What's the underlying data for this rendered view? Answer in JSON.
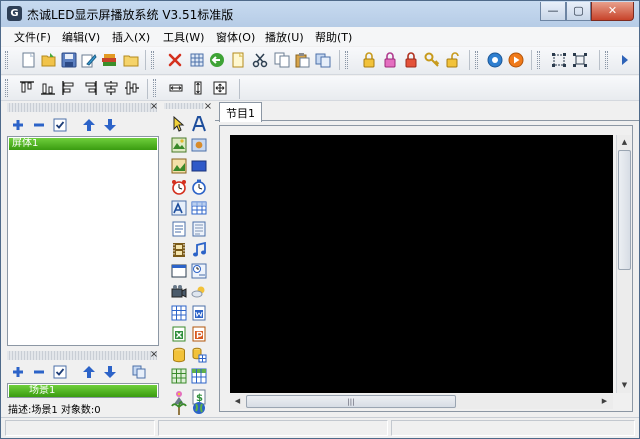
{
  "window": {
    "title": "杰诚LED显示屏播放系统 V3.51标准版",
    "logo_glyph": "G",
    "controls": {
      "minimize": "—",
      "maximize": "▢",
      "close": "✕"
    }
  },
  "menu": [
    {
      "label": "文件(F)"
    },
    {
      "label": "编辑(V)"
    },
    {
      "label": "插入(X)"
    },
    {
      "label": "工具(W)"
    },
    {
      "label": "窗体(O)"
    },
    {
      "label": "播放(U)"
    },
    {
      "label": "帮助(T)"
    }
  ],
  "toolbar_main": [
    {
      "icon": "new-file-icon"
    },
    {
      "icon": "open-folder-icon"
    },
    {
      "icon": "save-icon"
    },
    {
      "icon": "edit-icon"
    },
    {
      "icon": "books-icon"
    },
    {
      "icon": "folder-icon"
    },
    {
      "icon": "delete-icon"
    },
    {
      "icon": "grid-icon"
    },
    {
      "icon": "go-back-icon"
    },
    {
      "icon": "page-icon"
    },
    {
      "icon": "cut-icon"
    },
    {
      "icon": "copy-icon"
    },
    {
      "icon": "paste-icon"
    },
    {
      "icon": "duplicate-icon"
    },
    {
      "icon": "lock-icon"
    },
    {
      "icon": "lock-pink-icon"
    },
    {
      "icon": "lock-red-icon"
    },
    {
      "icon": "key-icon"
    },
    {
      "icon": "unlock-icon"
    },
    {
      "icon": "stop-icon"
    },
    {
      "icon": "play-icon"
    },
    {
      "icon": "select-frame-icon"
    },
    {
      "icon": "resize-frame-icon"
    },
    {
      "icon": "toolbar-more-icon"
    }
  ],
  "toolbar_align": [
    {
      "icon": "align-top-icon"
    },
    {
      "icon": "align-bottom-icon"
    },
    {
      "icon": "align-left-icon"
    },
    {
      "icon": "align-right-icon"
    },
    {
      "icon": "align-center-h-icon"
    },
    {
      "icon": "align-center-v-icon"
    },
    {
      "icon": "same-width-icon"
    },
    {
      "icon": "same-height-icon"
    },
    {
      "icon": "same-size-icon"
    }
  ],
  "screens_panel": {
    "toolbar": [
      "add-icon",
      "remove-icon",
      "checkbox-icon",
      "move-up-icon",
      "move-down-icon"
    ],
    "items": [
      {
        "label": "屏体1",
        "selected": true
      }
    ]
  },
  "scenes_panel": {
    "toolbar": [
      "add-icon",
      "remove-icon",
      "checkbox-icon",
      "move-up-icon",
      "move-down-icon",
      "copy-icon"
    ],
    "items": [
      {
        "label": "场景1",
        "selected": true
      }
    ]
  },
  "palette": [
    {
      "icon": "pointer-icon"
    },
    {
      "icon": "text-a-icon"
    },
    {
      "icon": "picture-icon"
    },
    {
      "icon": "photo-icon"
    },
    {
      "icon": "image-icon"
    },
    {
      "icon": "blue-rect-icon"
    },
    {
      "icon": "alarm-clock-icon"
    },
    {
      "icon": "stopwatch-icon"
    },
    {
      "icon": "text-image-icon"
    },
    {
      "icon": "table-icon"
    },
    {
      "icon": "document-icon"
    },
    {
      "icon": "page-lines-icon"
    },
    {
      "icon": "film-icon"
    },
    {
      "icon": "music-note-icon"
    },
    {
      "icon": "window-icon"
    },
    {
      "icon": "clock-text-icon"
    },
    {
      "icon": "video-camera-icon"
    },
    {
      "icon": "weather-icon"
    },
    {
      "icon": "grid-table-icon"
    },
    {
      "icon": "word-icon"
    },
    {
      "icon": "excel-icon"
    },
    {
      "icon": "powerpoint-icon"
    },
    {
      "icon": "database-icon"
    },
    {
      "icon": "database-grid-icon"
    },
    {
      "icon": "spreadsheet-icon"
    },
    {
      "icon": "spreadsheet-green-icon"
    },
    {
      "icon": "flower-icon"
    },
    {
      "icon": "dollar-doc-icon"
    },
    {
      "icon": "palm-tree-icon"
    },
    {
      "icon": "globe-icon"
    }
  ],
  "editor": {
    "tabs": [
      {
        "label": "节目1"
      }
    ],
    "scrollbar_arrows": {
      "up": "▲",
      "down": "▼",
      "left": "◀",
      "right": "▶"
    },
    "hscroll_grip": "|||"
  },
  "status": {
    "description": "描述:场景1 对象数:0"
  }
}
